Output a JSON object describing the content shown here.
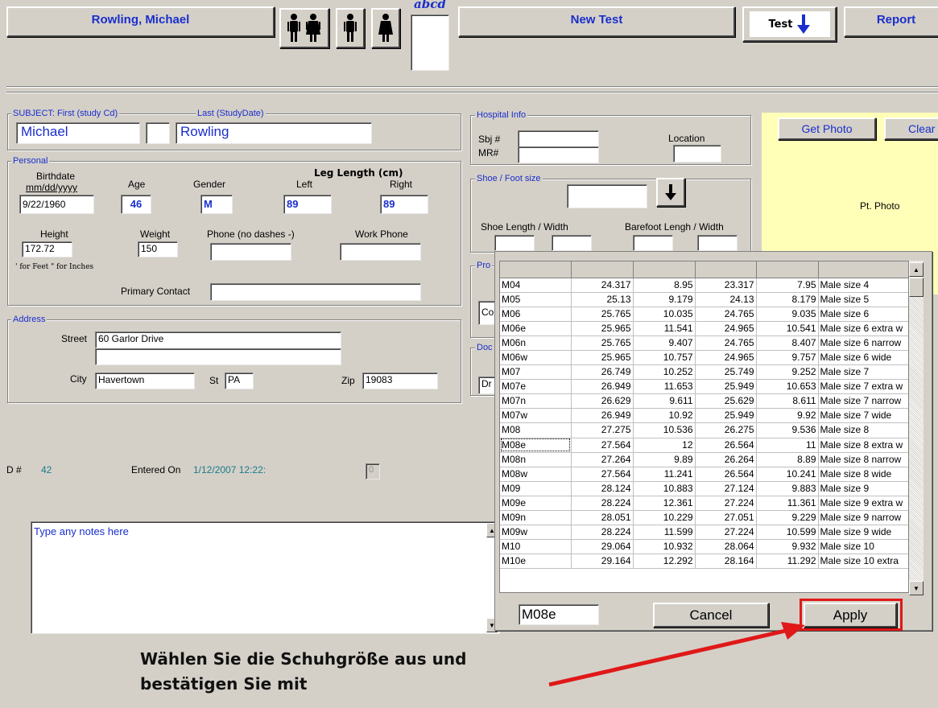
{
  "header": {
    "patient_name": "Rowling, Michael",
    "sample_text": "abcd",
    "new_test": "New Test",
    "test": "Test",
    "report": "Report"
  },
  "subject": {
    "title_first": "SUBJECT: First (study Cd)",
    "title_last": "Last (StudyDate)",
    "first": "Michael",
    "middle": "",
    "last": "Rowling"
  },
  "personal": {
    "title": "Personal",
    "birthdate_label": "Birthdate",
    "birthdate_format": "mm/dd/yyyy",
    "birthdate": "9/22/1960",
    "age_label": "Age",
    "age": "46",
    "gender_label": "Gender",
    "gender": "M",
    "leg_length_label": "Leg Length (cm)",
    "left_label": "Left",
    "left": "89",
    "right_label": "Right",
    "right": "89",
    "height_label": "Height",
    "height": "172.72",
    "weight_label": "Weight",
    "weight": "150",
    "phone_label": "Phone (no dashes -)",
    "phone": "",
    "work_phone_label": "Work Phone",
    "work_phone": "",
    "feet_inches_hint": "' for Feet  \" for Inches",
    "primary_contact_label": "Primary Contact",
    "primary_contact": ""
  },
  "address": {
    "title": "Address",
    "street_label": "Street",
    "street1": "60 Garlor Drive",
    "street2": "",
    "city_label": "City",
    "city": "Havertown",
    "st_label": "St",
    "st": "PA",
    "zip_label": "Zip",
    "zip": "19083"
  },
  "meta": {
    "id_label": "D #",
    "id": "42",
    "entered_label": "Entered On",
    "entered": "1/12/2007 12:22:",
    "counter": "0"
  },
  "notes": {
    "placeholder": "Type any notes here"
  },
  "hospital": {
    "title": "Hospital Info",
    "sbj_label": "Sbj #",
    "sbj": "",
    "mr_label": "MR#",
    "mr": "",
    "location_label": "Location",
    "location": ""
  },
  "shoe": {
    "title": "Shoe / Foot size",
    "shoe_lw_label": "Shoe Length  / Width",
    "barefoot_lw_label": "Barefoot Lengh / Width"
  },
  "partial": {
    "pro": "Pro",
    "co": "Co",
    "doc": "Doc",
    "dr": "Dr"
  },
  "photo": {
    "get_photo": "Get Photo",
    "clear": "Clear P",
    "placeholder": "Pt. Photo"
  },
  "popup": {
    "columns": [
      "",
      "",
      "",
      "",
      "",
      ""
    ],
    "rows": [
      [
        "M04",
        "24.317",
        "8.95",
        "23.317",
        "7.95",
        "Male size 4"
      ],
      [
        "M05",
        "25.13",
        "9.179",
        "24.13",
        "8.179",
        "Male size 5"
      ],
      [
        "M06",
        "25.765",
        "10.035",
        "24.765",
        "9.035",
        "Male size 6"
      ],
      [
        "M06e",
        "25.965",
        "11.541",
        "24.965",
        "10.541",
        "Male size 6 extra w"
      ],
      [
        "M06n",
        "25.765",
        "9.407",
        "24.765",
        "8.407",
        "Male size 6 narrow"
      ],
      [
        "M06w",
        "25.965",
        "10.757",
        "24.965",
        "9.757",
        "Male size 6 wide"
      ],
      [
        "M07",
        "26.749",
        "10.252",
        "25.749",
        "9.252",
        "Male size 7"
      ],
      [
        "M07e",
        "26.949",
        "11.653",
        "25.949",
        "10.653",
        "Male size 7 extra w"
      ],
      [
        "M07n",
        "26.629",
        "9.611",
        "25.629",
        "8.611",
        "Male size 7 narrow"
      ],
      [
        "M07w",
        "26.949",
        "10.92",
        "25.949",
        "9.92",
        "Male size 7 wide"
      ],
      [
        "M08",
        "27.275",
        "10.536",
        "26.275",
        "9.536",
        "Male size 8"
      ],
      [
        "M08e",
        "27.564",
        "12",
        "26.564",
        "11",
        "Male size 8 extra w"
      ],
      [
        "M08n",
        "27.264",
        "9.89",
        "26.264",
        "8.89",
        "Male size 8 narrow"
      ],
      [
        "M08w",
        "27.564",
        "11.241",
        "26.564",
        "10.241",
        "Male size 8 wide"
      ],
      [
        "M09",
        "28.124",
        "10.883",
        "27.124",
        "9.883",
        "Male size 9"
      ],
      [
        "M09e",
        "28.224",
        "12.361",
        "27.224",
        "11.361",
        "Male size 9 extra w"
      ],
      [
        "M09n",
        "28.051",
        "10.229",
        "27.051",
        "9.229",
        "Male size 9 narrow"
      ],
      [
        "M09w",
        "28.224",
        "11.599",
        "27.224",
        "10.599",
        "Male size 9 wide"
      ],
      [
        "M10",
        "29.064",
        "10.932",
        "28.064",
        "9.932",
        "Male size 10"
      ],
      [
        "M10e",
        "29.164",
        "12.292",
        "28.164",
        "11.292",
        "Male size 10 extra"
      ]
    ],
    "selected_code": "M08e",
    "cancel": "Cancel",
    "apply": "Apply"
  },
  "callout": {
    "line1": "Wählen Sie die Schuhgröße aus und",
    "line2": "bestätigen Sie mit"
  },
  "colors": {
    "accent_blue": "#1a2ecc",
    "teal": "#1a7a8a",
    "photo_bg": "#ffffb8",
    "highlight_red": "#e01818"
  }
}
